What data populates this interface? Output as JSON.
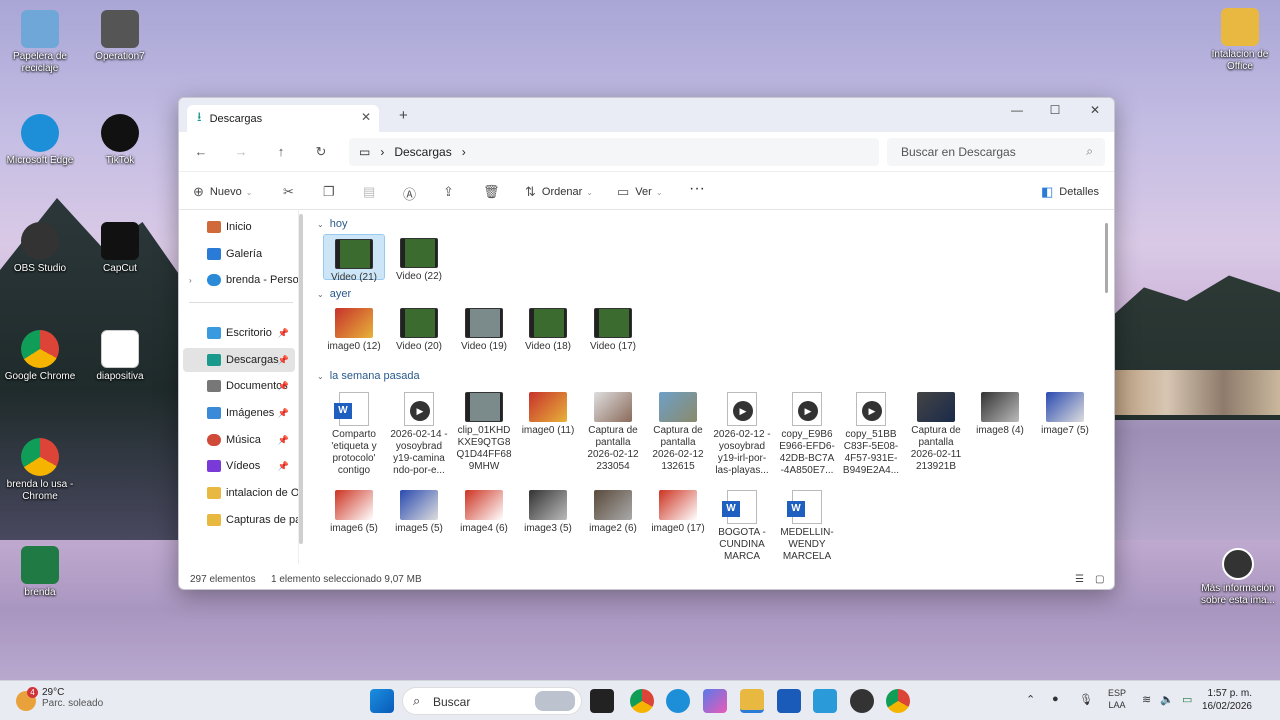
{
  "desktop": {
    "left_icons": [
      {
        "label": "Papelera de reciclaje",
        "color": "#6fa8d8"
      },
      {
        "label": "Operation7",
        "color": "#555555"
      },
      {
        "label": "Microsoft Edge",
        "color": "#1d8fd8"
      },
      {
        "label": "TikTok",
        "color": "#111111"
      },
      {
        "label": "OBS Studio",
        "color": "#333333"
      },
      {
        "label": "CapCut",
        "color": "#111111"
      },
      {
        "label": "Google Chrome",
        "color": "#2a8a3a"
      },
      {
        "label": "diapositiva",
        "color": "#ffffff"
      },
      {
        "label": "brenda lo usa - Chrome",
        "color": "#2a8a3a"
      },
      {
        "label": "brenda",
        "color": "#1f7a44"
      }
    ],
    "right_icons": [
      {
        "label": "Intalacion de Office",
        "color": "#e9b840"
      },
      {
        "label": "Más información sobre esta ima...",
        "color": "#333333"
      }
    ]
  },
  "explorer": {
    "tab_title": "Descargas",
    "new_tab": "+",
    "window_controls": {
      "minimize": "—",
      "maximize": "☐",
      "close": "✕"
    },
    "breadcrumb": "Descargas",
    "search_placeholder": "Buscar en Descargas",
    "toolbar": {
      "new": "Nuevo",
      "sort": "Ordenar",
      "view": "Ver",
      "more": "···",
      "details": "Detalles"
    },
    "sidebar": [
      {
        "label": "Inicio",
        "color": "#d06a3a"
      },
      {
        "label": "Galería",
        "color": "#2a7ad8"
      },
      {
        "label": "brenda - Persona",
        "color": "#2a8ad8"
      },
      {
        "label": "Escritorio",
        "color": "#3a9ae0"
      },
      {
        "label": "Descargas",
        "color": "#1a9a8c"
      },
      {
        "label": "Documentos",
        "color": "#777777"
      },
      {
        "label": "Imágenes",
        "color": "#3a8ad8"
      },
      {
        "label": "Música",
        "color": "#d04a3a"
      },
      {
        "label": "Vídeos",
        "color": "#7a3ad8"
      },
      {
        "label": "intalacion de Of",
        "color": "#e9b840"
      },
      {
        "label": "Capturas de pan",
        "color": "#e9b840"
      }
    ],
    "groups": [
      "hoy",
      "ayer",
      "la semana pasada"
    ],
    "files_today": [
      "Video (21)",
      "Video (22)"
    ],
    "files_yesterday": [
      "image0 (12)",
      "Video (20)",
      "Video (19)",
      "Video (18)",
      "Video (17)"
    ],
    "files_last_week_row1": [
      "Comparto 'etiqueta y protocolo' contigo",
      "2026-02-14 -yosoybrad y19-camina ndo-por-e...",
      "clip_01KHD KXE9QTG8 Q1D44FF68 9MHW",
      "image0 (11)",
      "Captura de pantalla 2026-02-12 233054",
      "Captura de pantalla 2026-02-12 132615",
      "2026-02-12 -yosoybrad y19-irl-por- las-playas...",
      "copy_E9B6 E966-EFD6- 42DB-BC7A -4A850E7...",
      "copy_51BB C83F-5E08- 4F57-931E- B949E2A4...",
      "Captura de pantalla 2026-02-11 213921B",
      "image8 (4)",
      "image7 (5)"
    ],
    "files_last_week_row2": [
      "image6 (5)",
      "image5 (5)",
      "image4 (6)",
      "image3 (5)",
      "image2 (6)",
      "image0 (17)",
      "BOGOTA - CUNDINA MARCA",
      "MEDELLIN- WENDY MARCELA"
    ],
    "status": {
      "count": "297 elementos",
      "selection": "1 elemento seleccionado  9,07 MB"
    }
  },
  "taskbar": {
    "weather_temp": "29°C",
    "weather_desc": "Parc. soleado",
    "weather_badge": "4",
    "search": "Buscar",
    "lang": "ESP",
    "lang2": "LAA",
    "time": "1:57 p. m.",
    "date": "16/02/2026"
  }
}
